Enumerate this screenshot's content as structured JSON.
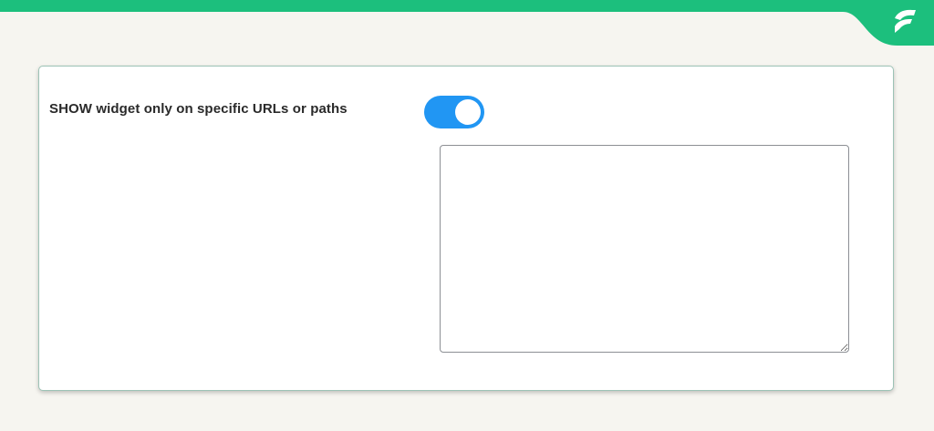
{
  "brand": {
    "logo_icon": "brand-logo-icon",
    "accent_color": "#1cbf7d"
  },
  "setting": {
    "label": "SHOW widget only on specific URLs or paths",
    "toggle_on": true,
    "toggle_color": "#2196f3",
    "textarea_value": "",
    "textarea_placeholder": ""
  }
}
